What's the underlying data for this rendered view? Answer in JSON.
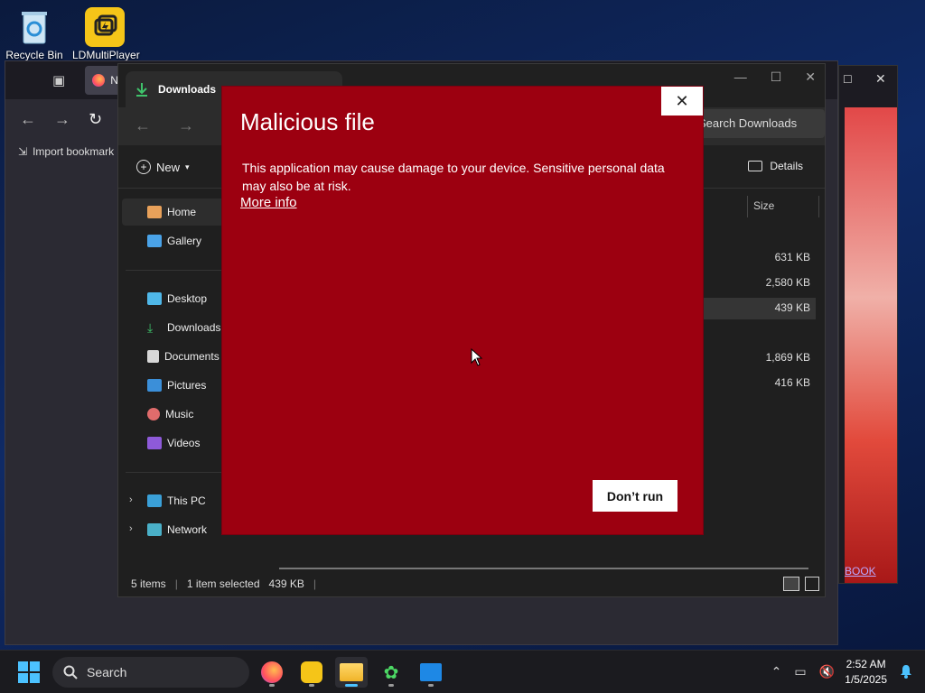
{
  "desktop": {
    "icons": [
      {
        "label": "Recycle Bin"
      },
      {
        "label": "LDMultiPlayer"
      }
    ]
  },
  "browser": {
    "tab_partial": "N",
    "bookmark": "Import bookmark"
  },
  "red_window": {
    "link_partial": "BOOK"
  },
  "explorer": {
    "tab_title": "Downloads",
    "add_tab": "+",
    "search_placeholder": "Search Downloads",
    "new_label": "New",
    "details_label": "Details",
    "size_header": "Size",
    "sidebar": [
      {
        "label": "Home"
      },
      {
        "label": "Gallery"
      },
      {
        "label": "Desktop"
      },
      {
        "label": "Downloads"
      },
      {
        "label": "Documents"
      },
      {
        "label": "Pictures"
      },
      {
        "label": "Music"
      },
      {
        "label": "Videos"
      },
      {
        "label": "This PC"
      },
      {
        "label": "Network"
      }
    ],
    "sizes": [
      "631 KB",
      "2,580 KB",
      "439 KB",
      "1,869 KB",
      "416 KB"
    ],
    "status": {
      "items": "5 items",
      "selected": "1 item selected",
      "selected_size": "439 KB"
    }
  },
  "dialog": {
    "title": "Malicious file",
    "message": "This application may cause damage to your device. Sensitive personal data may also be at risk.",
    "more_info": "More info",
    "dont_run": "Don’t run",
    "close": "✕"
  },
  "taskbar": {
    "search_placeholder": "Search",
    "time": "2:52 AM",
    "date": "1/5/2025"
  },
  "colors": {
    "dialog_bg": "#9c0010",
    "accent": "#4cc2ff"
  }
}
